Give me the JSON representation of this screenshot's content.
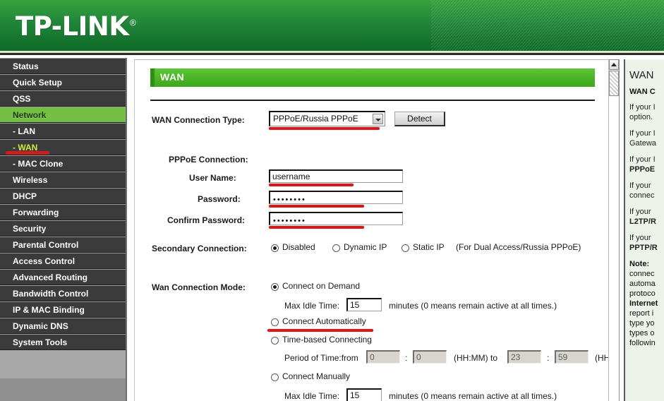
{
  "brand": {
    "name": "TP-LINK",
    "registered_mark": "®"
  },
  "sidebar": {
    "items": [
      {
        "label": "Status",
        "state": "normal"
      },
      {
        "label": "Quick Setup",
        "state": "normal"
      },
      {
        "label": "QSS",
        "state": "normal"
      },
      {
        "label": "Network",
        "state": "active"
      },
      {
        "label": "- LAN",
        "state": "normal"
      },
      {
        "label": "- WAN",
        "state": "highlight"
      },
      {
        "label": "- MAC Clone",
        "state": "normal"
      },
      {
        "label": "Wireless",
        "state": "normal"
      },
      {
        "label": "DHCP",
        "state": "normal"
      },
      {
        "label": "Forwarding",
        "state": "normal"
      },
      {
        "label": "Security",
        "state": "normal"
      },
      {
        "label": "Parental Control",
        "state": "normal"
      },
      {
        "label": "Access Control",
        "state": "normal"
      },
      {
        "label": "Advanced Routing",
        "state": "normal"
      },
      {
        "label": "Bandwidth Control",
        "state": "normal"
      },
      {
        "label": "IP & MAC Binding",
        "state": "normal"
      },
      {
        "label": "Dynamic DNS",
        "state": "normal"
      },
      {
        "label": "System Tools",
        "state": "normal"
      }
    ]
  },
  "main": {
    "banner_title": "WAN",
    "wan_connection_type": {
      "label": "WAN Connection Type:",
      "value": "PPPoE/Russia PPPoE",
      "detect_button": "Detect"
    },
    "pppoe": {
      "section_label": "PPPoE Connection:",
      "username_label": "User Name:",
      "username_value": "username",
      "password_label": "Password:",
      "password_value": "••••••••",
      "confirm_label": "Confirm Password:",
      "confirm_value": "••••••••"
    },
    "secondary_connection": {
      "label": "Secondary Connection:",
      "options": [
        {
          "label": "Disabled",
          "selected": true
        },
        {
          "label": "Dynamic IP",
          "selected": false
        },
        {
          "label": "Static IP",
          "selected": false
        }
      ],
      "note": "(For Dual Access/Russia PPPoE)"
    },
    "wan_connection_mode": {
      "label": "Wan Connection Mode:",
      "connect_on_demand": "Connect on Demand",
      "connect_on_demand_selected": true,
      "max_idle_time_label": "Max Idle Time:",
      "max_idle_time_value": "15",
      "max_idle_time_suffix": "minutes (0 means remain active at all times.)",
      "connect_automatically": "Connect Automatically",
      "connect_automatically_selected": false,
      "time_based_connecting": "Time-based Connecting",
      "time_based_connecting_selected": false,
      "period_label": "Period of Time:from",
      "period_from_hh": "0",
      "period_from_mm": "0",
      "period_mid_text": "(HH:MM) to",
      "period_to_hh": "23",
      "period_to_mm": "59",
      "period_tail_text": "(HH",
      "connect_manually": "Connect Manually",
      "connect_manually_selected": false,
      "manual_idle_label": "Max Idle Time:",
      "manual_idle_value": "15",
      "manual_idle_suffix": "minutes (0 means remain active at all times.)"
    }
  },
  "help": {
    "title": "WAN",
    "subtitle": "WAN C",
    "paragraphs": [
      "If your I",
      "option.",
      "If your I",
      "Gatewa",
      "If your I",
      "PPPoE",
      "If  your",
      "connec",
      "If  your",
      "L2TP/R",
      "If  your",
      "PPTP/R"
    ],
    "note_label": "Note:",
    "note_lines": [
      "connec",
      "automa",
      "protoco",
      "Internet",
      "report i",
      "type yo",
      "types o",
      "followin"
    ]
  },
  "colors": {
    "brand_green": "#22873a",
    "accent_green": "#74c044",
    "annotation_red": "#cc1e1e",
    "sidebar_dark": "#3b3b3b"
  }
}
